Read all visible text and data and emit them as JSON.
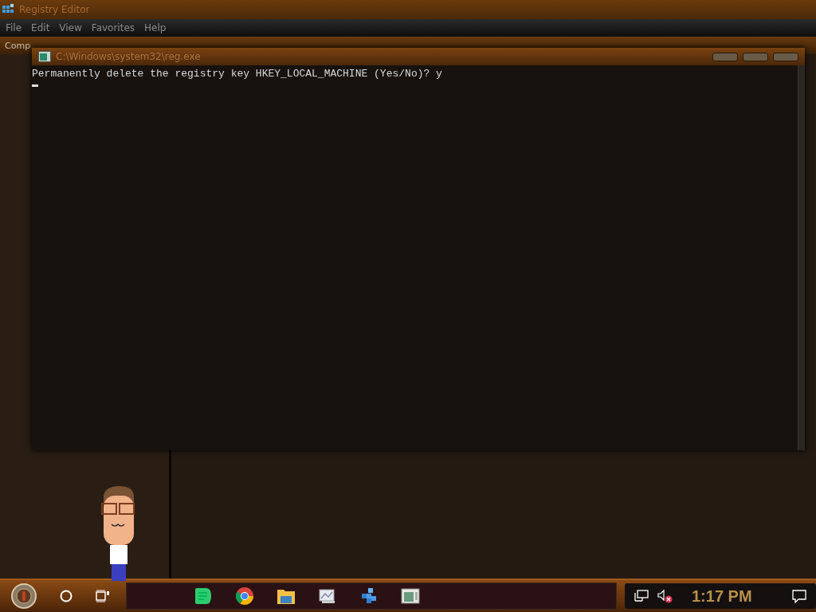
{
  "registry_editor": {
    "title": "Registry Editor",
    "menu": [
      "File",
      "Edit",
      "View",
      "Favorites",
      "Help"
    ],
    "address": "Comp"
  },
  "console": {
    "title": "C:\\Windows\\system32\\reg.exe",
    "lines": [
      "Permanently delete the registry key HKEY_LOCAL_MACHINE (Yes/No)? y"
    ]
  },
  "taskbar": {
    "apps": [
      {
        "kind": "chat"
      },
      {
        "kind": "browser"
      },
      {
        "kind": "folder"
      },
      {
        "kind": "pictures"
      },
      {
        "kind": "cubes"
      },
      {
        "kind": "console"
      }
    ],
    "volume_muted": true,
    "clock": "1:17 PM"
  }
}
